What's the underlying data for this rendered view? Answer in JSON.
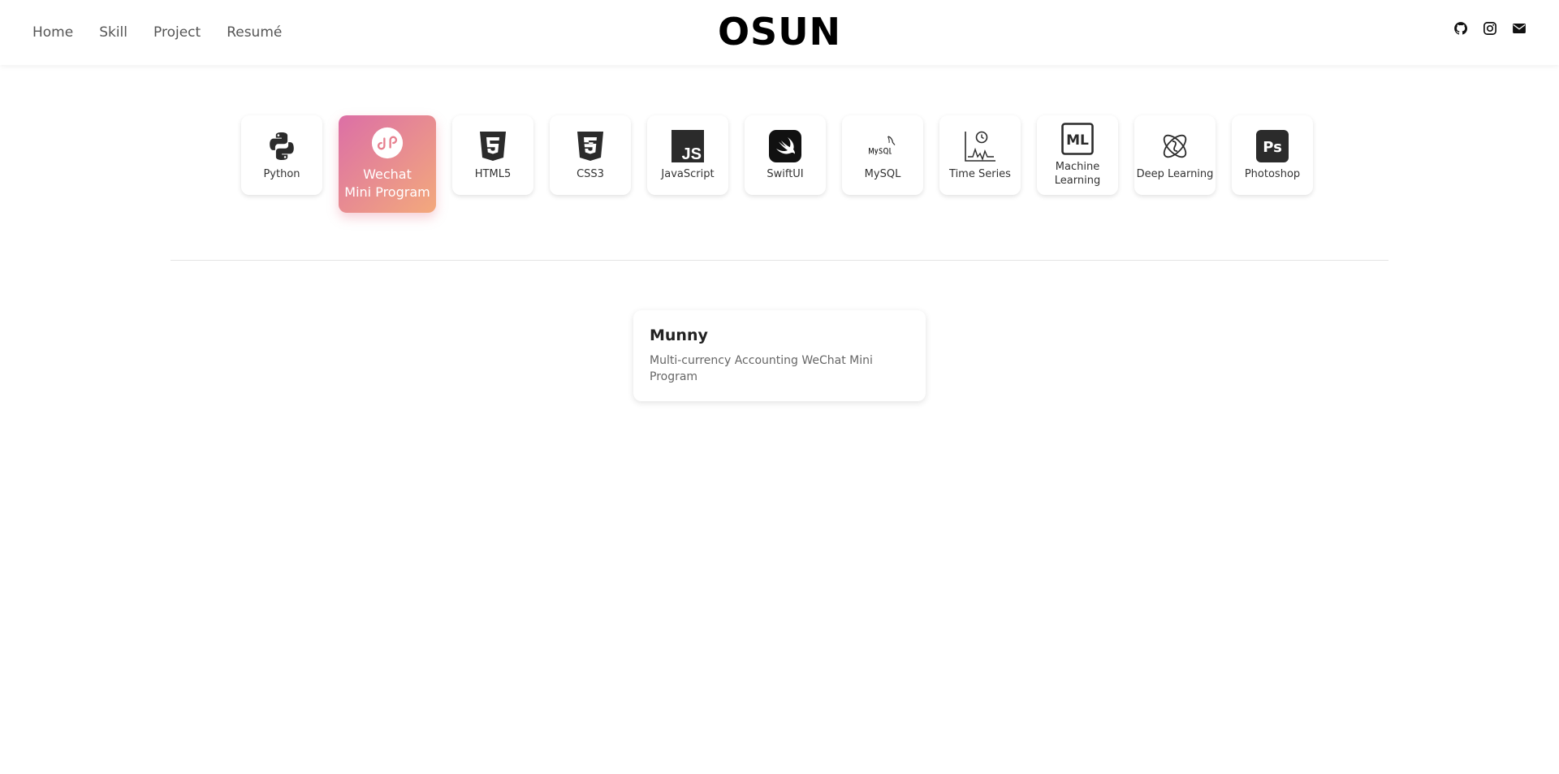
{
  "header": {
    "logo": "OSUN",
    "nav": [
      "Home",
      "Skill",
      "Project",
      "Resumé"
    ],
    "social_icons": [
      "github-icon",
      "instagram-icon",
      "mail-icon"
    ]
  },
  "skills": [
    {
      "label": "Python",
      "icon": "python-icon"
    },
    {
      "label": "Wechat\nMini Program",
      "icon": "wechat-mini-program-icon",
      "active": true
    },
    {
      "label": "HTML5",
      "icon": "html5-icon"
    },
    {
      "label": "CSS3",
      "icon": "css3-icon"
    },
    {
      "label": "JavaScript",
      "icon": "javascript-icon"
    },
    {
      "label": "SwiftUI",
      "icon": "swift-icon"
    },
    {
      "label": "MySQL",
      "icon": "mysql-icon"
    },
    {
      "label": "Time Series",
      "icon": "time-series-icon"
    },
    {
      "label": "Machine\nLearning",
      "icon": "machine-learning-icon"
    },
    {
      "label": "Deep Learning",
      "icon": "deep-learning-icon"
    },
    {
      "label": "Photoshop",
      "icon": "photoshop-icon"
    }
  ],
  "project": {
    "title": "Munny",
    "description": "Multi-currency Accounting WeChat Mini Program"
  },
  "colors": {
    "active_gradient_start": "#dc6fa6",
    "active_gradient_end": "#f3a97c",
    "icon_dark": "#2b2b2b"
  }
}
